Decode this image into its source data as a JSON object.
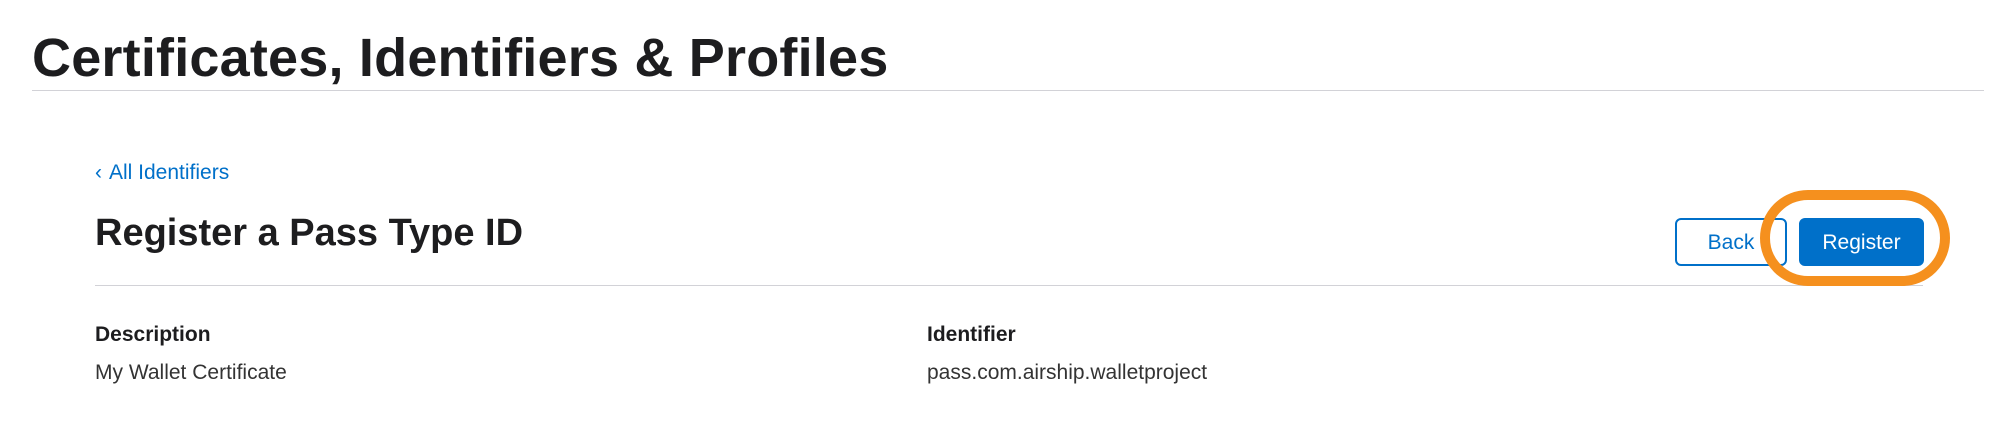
{
  "header": {
    "title": "Certificates, Identifiers & Profiles"
  },
  "nav": {
    "back_link_label": "All Identifiers",
    "back_link_icon": "chevron-left-icon"
  },
  "section": {
    "title": "Register a Pass Type ID"
  },
  "actions": {
    "back_label": "Back",
    "register_label": "Register"
  },
  "fields": {
    "description": {
      "label": "Description",
      "value": "My Wallet Certificate"
    },
    "identifier": {
      "label": "Identifier",
      "value": "pass.com.airship.walletproject"
    }
  },
  "colors": {
    "accent": "#0070c9",
    "highlight": "#f5901e",
    "text": "#1d1d1f",
    "divider": "#d2d2d7"
  }
}
